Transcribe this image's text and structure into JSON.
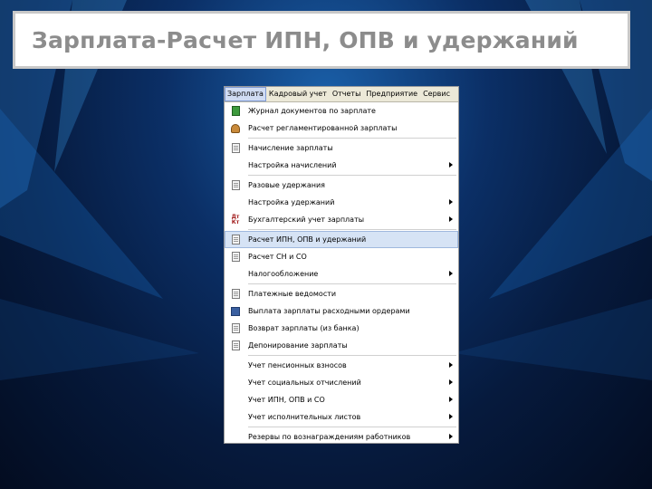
{
  "slide": {
    "title": "Зарплата-Расчет ИПН, ОПВ и удержаний"
  },
  "colors": {
    "background_center": "#1a5fa8",
    "background_edge": "#030c20",
    "title_text": "#8c8c8c",
    "menu_highlight": "#d6e3f5"
  },
  "menubar": {
    "items": [
      {
        "label": "Зарплата",
        "active": true
      },
      {
        "label": "Кадровый учет"
      },
      {
        "label": "Отчеты"
      },
      {
        "label": "Предприятие"
      },
      {
        "label": "Сервис"
      }
    ]
  },
  "menu": {
    "items": [
      {
        "label": "Журнал документов по зарплате",
        "icon": "green-journal-icon",
        "submenu": false
      },
      {
        "label": "Расчет регламентированной зарплаты",
        "icon": "person-calc-icon",
        "submenu": false
      },
      {
        "label": "Начисление зарплаты",
        "icon": "document-icon",
        "submenu": false
      },
      {
        "label": "Настройка начислений",
        "icon": "",
        "submenu": true
      },
      {
        "label": "Разовые удержания",
        "icon": "document-icon",
        "submenu": false
      },
      {
        "label": "Настройка удержаний",
        "icon": "",
        "submenu": true
      },
      {
        "label": "Бухгалтерский учет зарплаты",
        "icon": "dt-kt-icon",
        "submenu": true
      },
      {
        "label": "Расчет ИПН, ОПВ и удержаний",
        "icon": "document-icon",
        "submenu": false,
        "highlight": true
      },
      {
        "label": "Расчет СН и СО",
        "icon": "document-icon",
        "submenu": false
      },
      {
        "label": "Налогообложение",
        "icon": "",
        "submenu": true
      },
      {
        "label": "Платежные ведомости",
        "icon": "document-icon",
        "submenu": false
      },
      {
        "label": "Выплата зарплаты расходными ордерами",
        "icon": "disk-icon",
        "submenu": false
      },
      {
        "label": "Возврат зарплаты (из банка)",
        "icon": "document-icon",
        "submenu": false
      },
      {
        "label": "Депонирование зарплаты",
        "icon": "document-icon",
        "submenu": false
      },
      {
        "label": "Учет пенсионных взносов",
        "icon": "",
        "submenu": true
      },
      {
        "label": "Учет социальных отчислений",
        "icon": "",
        "submenu": true
      },
      {
        "label": "Учет ИПН, ОПВ и СО",
        "icon": "",
        "submenu": true
      },
      {
        "label": "Учет исполнительных листов",
        "icon": "",
        "submenu": true
      },
      {
        "label": "Резервы по вознаграждениям работников",
        "icon": "",
        "submenu": true
      }
    ]
  }
}
